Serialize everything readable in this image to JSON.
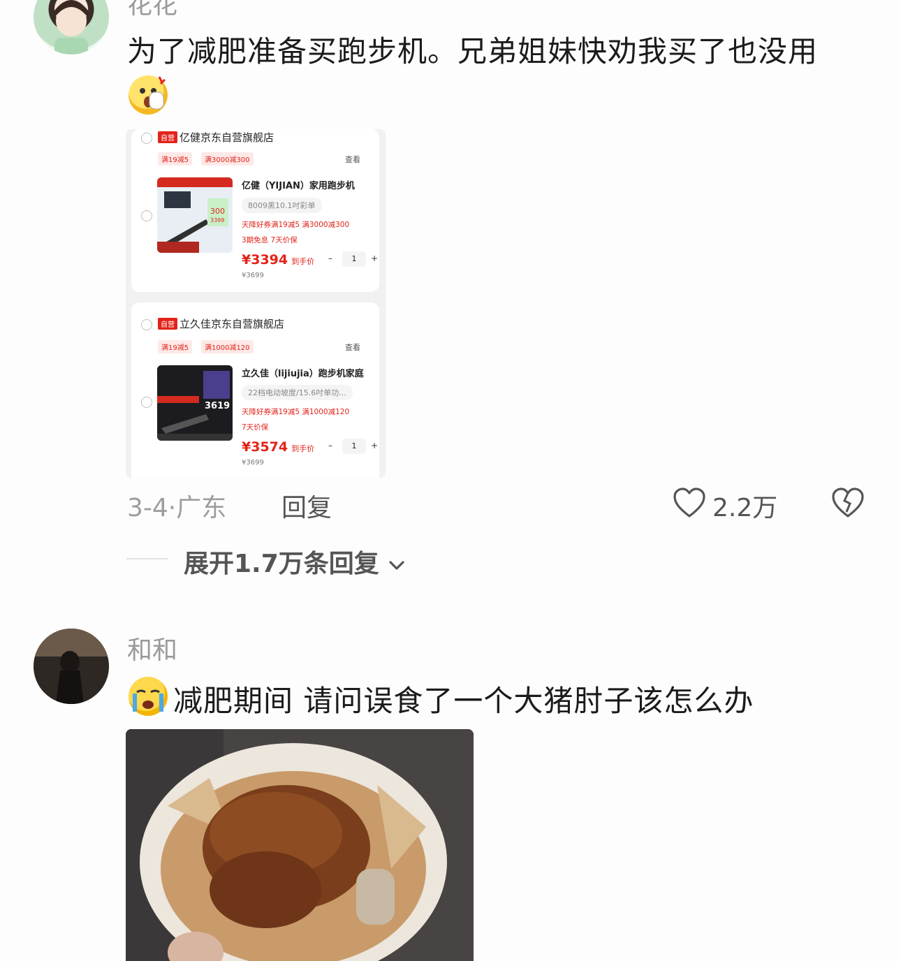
{
  "comment1": {
    "username": "花花",
    "text": "为了减肥准备买跑步机。兄弟姐妹快劝我买了也没用",
    "date_location": "3-4·广东",
    "reply_label": "回复",
    "likes": "2.2万",
    "expand_label": "展开1.7万条回复",
    "cart": {
      "stores": [
        {
          "self_tag": "自营",
          "store_name": "亿健京东自营旗舰店",
          "coupons": [
            "满19减5",
            "满3000减300"
          ],
          "see_label": "查看",
          "product_name": "亿健（YIJIAN）家用跑步机",
          "variant": "8009黑10.1吋彩单",
          "promo_line1": "天降好券满19减5  满3000减300",
          "promo_line2": "3期免息  7天价保",
          "price": "¥3394",
          "price_suffix": "到手价",
          "original_price": "¥3699",
          "quantity": "1",
          "thumb_price_a": "300",
          "thumb_price_b": "3399"
        },
        {
          "self_tag": "自营",
          "store_name": "立久佳京东自营旗舰店",
          "coupons": [
            "满19减5",
            "满1000减120"
          ],
          "see_label": "查看",
          "product_name": "立久佳（lijiujia）跑步机家庭",
          "variant": "22档电动坡度/15.6吋单功...",
          "promo_line1": "天降好券满19减5  满1000减120",
          "promo_line2": "7天价保",
          "price": "¥3574",
          "price_suffix": "到手价",
          "original_price": "¥3699",
          "quantity": "1",
          "thumb_price_a": "3619"
        }
      ]
    }
  },
  "comment2": {
    "username": "和和",
    "text": "减肥期间 请问误食了一个大猪肘子该怎么办"
  },
  "colors": {
    "accent_red": "#e2231a",
    "meta_gray": "#9d9d9d",
    "text_dark": "#1b1b1b"
  },
  "icons": {
    "like": "heart-outline-icon",
    "dislike": "broken-heart-icon",
    "expand": "chevron-down-icon"
  }
}
